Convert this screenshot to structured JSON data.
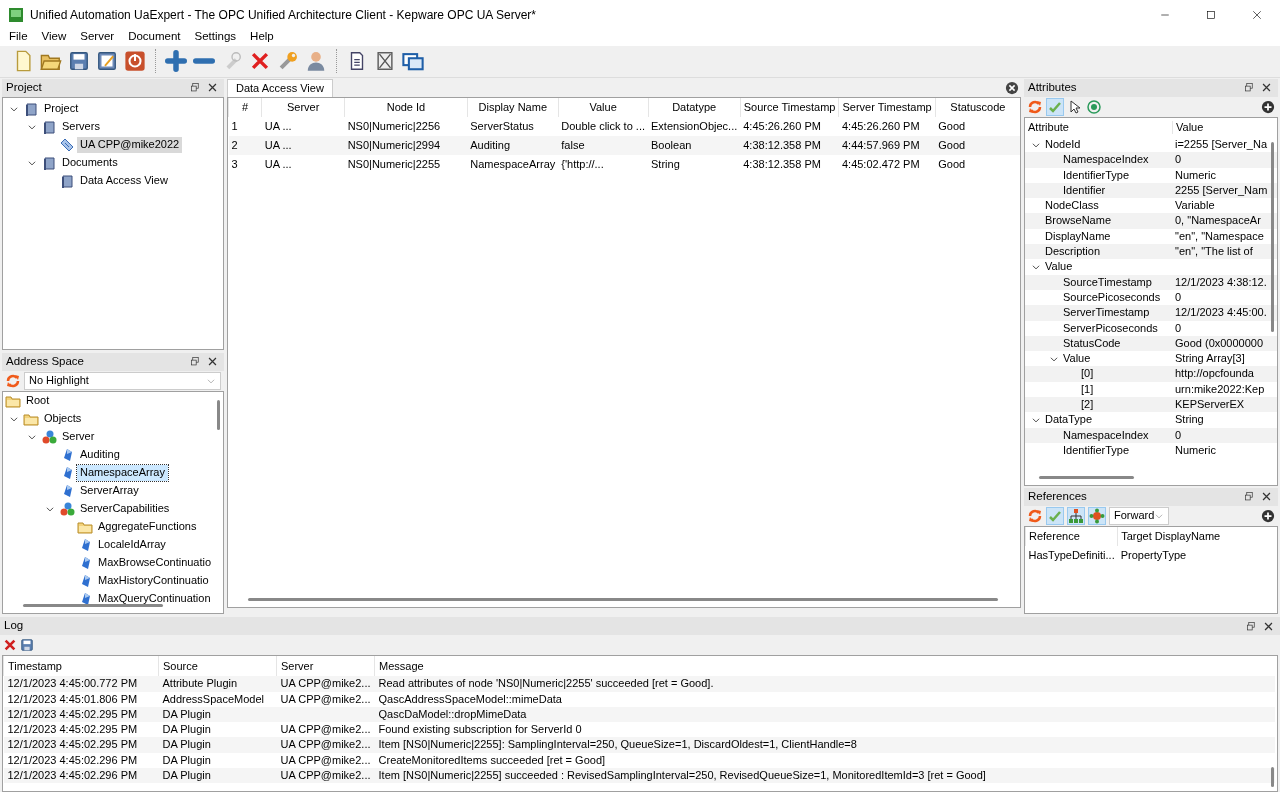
{
  "window": {
    "title": "Unified Automation UaExpert - The OPC Unified Architecture Client - Kepware OPC UA Server*"
  },
  "menu": [
    "File",
    "View",
    "Server",
    "Document",
    "Settings",
    "Help"
  ],
  "project": {
    "title": "Project",
    "tree": [
      {
        "label": "Project",
        "kind": "project",
        "expanded": true,
        "selected": false,
        "children": [
          {
            "label": "Servers",
            "kind": "project",
            "expanded": true,
            "selected": false,
            "children": [
              {
                "label": "UA CPP@mike2022",
                "kind": "server",
                "selected": true
              }
            ]
          },
          {
            "label": "Documents",
            "kind": "project",
            "expanded": true,
            "selected": false,
            "children": [
              {
                "label": "Data Access View",
                "kind": "project",
                "selected": false
              }
            ]
          }
        ]
      }
    ]
  },
  "address_space": {
    "title": "Address Space",
    "highlight": "No Highlight",
    "tree": [
      {
        "label": "Root",
        "kind": "folder",
        "selected": false,
        "children": [
          {
            "label": "Objects",
            "kind": "folder",
            "expanded": true,
            "selected": false,
            "children": [
              {
                "label": "Server",
                "kind": "object",
                "expanded": true,
                "selected": false,
                "children": [
                  {
                    "label": "Auditing",
                    "kind": "variable",
                    "selected": false
                  },
                  {
                    "label": "NamespaceArray",
                    "kind": "variable",
                    "selected": true
                  },
                  {
                    "label": "ServerArray",
                    "kind": "variable",
                    "selected": false
                  },
                  {
                    "label": "ServerCapabilities",
                    "kind": "object",
                    "expanded": true,
                    "selected": false,
                    "children": [
                      {
                        "label": "AggregateFunctions",
                        "kind": "folder",
                        "selected": false
                      },
                      {
                        "label": "LocaleIdArray",
                        "kind": "variable",
                        "selected": false
                      },
                      {
                        "label": "MaxBrowseContinuatio",
                        "kind": "variable",
                        "selected": false
                      },
                      {
                        "label": "MaxHistoryContinuatio",
                        "kind": "variable",
                        "selected": false
                      },
                      {
                        "label": "MaxQueryContinuation",
                        "kind": "variable",
                        "selected": false
                      }
                    ]
                  }
                ]
              }
            ]
          }
        ]
      }
    ]
  },
  "data_access_view": {
    "tab": "Data Access View",
    "columns": [
      "#",
      "Server",
      "Node Id",
      "Display Name",
      "Value",
      "Datatype",
      "Source Timestamp",
      "Server Timestamp",
      "Statuscode"
    ],
    "rows": [
      [
        "1",
        "UA ...",
        "NS0|Numeric|2256",
        "ServerStatus",
        "Double click to ...",
        "ExtensionObjec...",
        "4:45:26.260 PM",
        "4:45:26.260 PM",
        "Good"
      ],
      [
        "2",
        "UA ...",
        "NS0|Numeric|2994",
        "Auditing",
        "false",
        "Boolean",
        "4:38:12.358 PM",
        "4:44:57.969 PM",
        "Good"
      ],
      [
        "3",
        "UA ...",
        "NS0|Numeric|2255",
        "NamespaceArray",
        "{'http://...",
        "String",
        "4:38:12.358 PM",
        "4:45:02.472 PM",
        "Good"
      ]
    ]
  },
  "attributes": {
    "title": "Attributes",
    "columns": [
      "Attribute",
      "Value"
    ],
    "rows": [
      {
        "name": "NodeId",
        "value": "i=2255 [Server_Na",
        "expanded": true,
        "children": [
          {
            "name": "NamespaceIndex",
            "value": "0"
          },
          {
            "name": "IdentifierType",
            "value": "Numeric"
          },
          {
            "name": "Identifier",
            "value": "2255 [Server_Nam"
          }
        ]
      },
      {
        "name": "NodeClass",
        "value": "Variable"
      },
      {
        "name": "BrowseName",
        "value": "0, \"NamespaceAr"
      },
      {
        "name": "DisplayName",
        "value": "\"en\", \"Namespace"
      },
      {
        "name": "Description",
        "value": "\"en\", \"The list of"
      },
      {
        "name": "Value",
        "expanded": true,
        "children": [
          {
            "name": "SourceTimestamp",
            "value": "12/1/2023 4:38:12."
          },
          {
            "name": "SourcePicoseconds",
            "value": "0"
          },
          {
            "name": "ServerTimestamp",
            "value": "12/1/2023 4:45:00."
          },
          {
            "name": "ServerPicoseconds",
            "value": "0"
          },
          {
            "name": "StatusCode",
            "value": "Good (0x0000000"
          },
          {
            "name": "Value",
            "value": "String Array[3]",
            "expanded": true,
            "children": [
              {
                "name": "[0]",
                "value": "http://opcfounda"
              },
              {
                "name": "[1]",
                "value": "urn:mike2022:Kep"
              },
              {
                "name": "[2]",
                "value": "KEPServerEX"
              }
            ]
          }
        ]
      },
      {
        "name": "DataType",
        "value": "String",
        "expanded": true,
        "children": [
          {
            "name": "NamespaceIndex",
            "value": "0"
          },
          {
            "name": "IdentifierType",
            "value": "Numeric"
          }
        ]
      }
    ]
  },
  "references": {
    "title": "References",
    "direction": "Forward",
    "columns": [
      "Reference",
      "Target DisplayName"
    ],
    "rows": [
      [
        "HasTypeDefiniti...",
        "PropertyType"
      ]
    ]
  },
  "log": {
    "title": "Log",
    "columns": [
      "Timestamp",
      "Source",
      "Server",
      "Message"
    ],
    "rows": [
      [
        "12/1/2023 4:45:00.772 PM",
        "Attribute Plugin",
        "UA CPP@mike2...",
        "Read attributes of node 'NS0|Numeric|2255' succeeded [ret = Good]."
      ],
      [
        "12/1/2023 4:45:01.806 PM",
        "AddressSpaceModel",
        "UA CPP@mike2...",
        "QascAddressSpaceModel::mimeData"
      ],
      [
        "12/1/2023 4:45:02.295 PM",
        "DA Plugin",
        "",
        "QascDaModel::dropMimeData"
      ],
      [
        "12/1/2023 4:45:02.295 PM",
        "DA Plugin",
        "UA CPP@mike2...",
        "Found existing subscription for ServerId 0"
      ],
      [
        "12/1/2023 4:45:02.295 PM",
        "DA Plugin",
        "UA CPP@mike2...",
        "Item [NS0|Numeric|2255]: SamplingInterval=250, QueueSize=1, DiscardOldest=1, ClientHandle=8"
      ],
      [
        "12/1/2023 4:45:02.296 PM",
        "DA Plugin",
        "UA CPP@mike2...",
        "CreateMonitoredItems succeeded [ret = Good]"
      ],
      [
        "12/1/2023 4:45:02.296 PM",
        "DA Plugin",
        "UA CPP@mike2...",
        "Item [NS0|Numeric|2255] succeeded : RevisedSamplingInterval=250, RevisedQueueSize=1, MonitoredItemId=3 [ret = Good]"
      ]
    ]
  }
}
